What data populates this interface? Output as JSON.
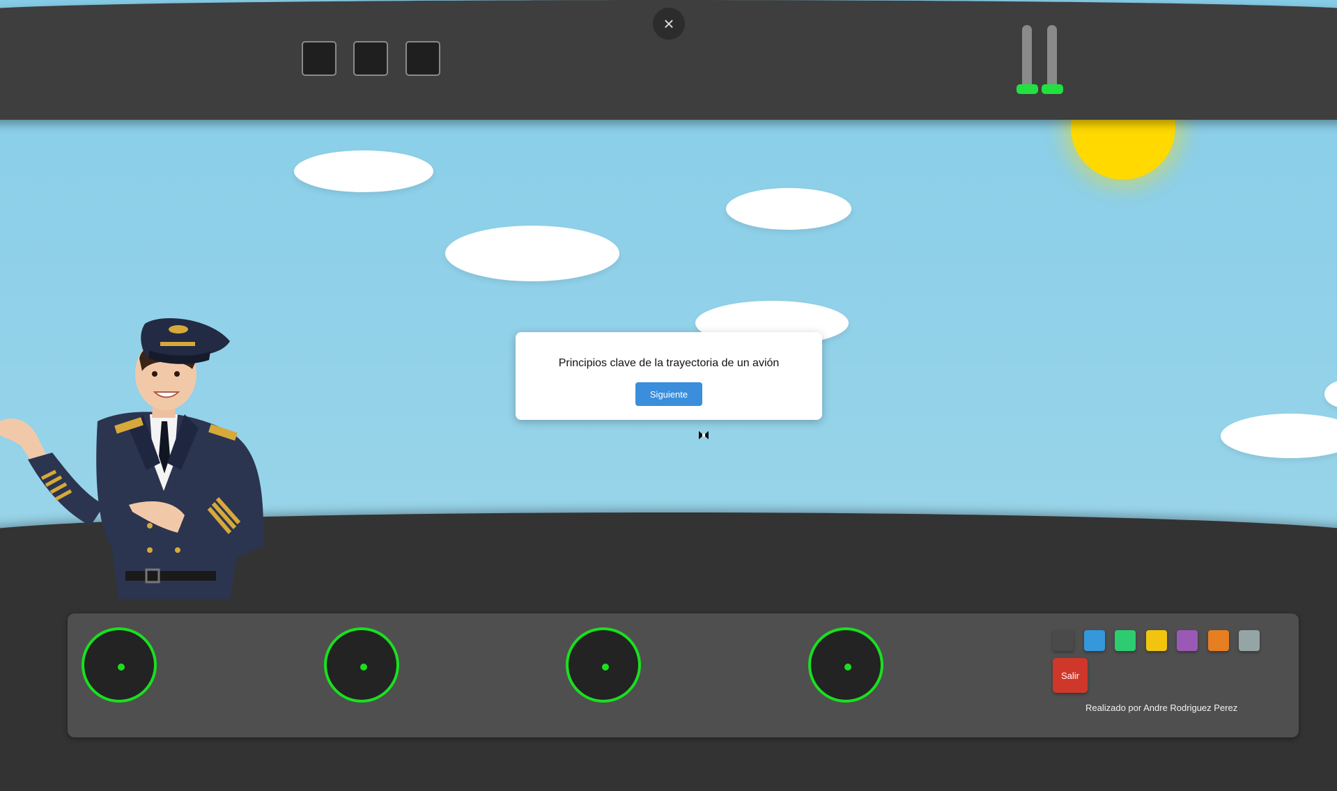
{
  "dialog": {
    "text": "Principios clave de la trayectoria de un avión",
    "next_label": "Siguiente"
  },
  "top_panel": {
    "close_icon": "×",
    "indicator_squares": 3,
    "levers": 2
  },
  "dashboard": {
    "gauges": 4,
    "color_swatches": [
      "#4a4a4a",
      "#3498db",
      "#2ecc71",
      "#f1c40f",
      "#9b59b6",
      "#e67e22",
      "#95a5a6"
    ],
    "exit_label": "Salir",
    "credit": "Realizado por Andre Rodriguez Perez"
  },
  "colors": {
    "gauge_ring": "#19e01f",
    "lever_knob": "#22e040",
    "sun": "#ffd900",
    "exit": "#d0372b",
    "next": "#3a8edb"
  }
}
